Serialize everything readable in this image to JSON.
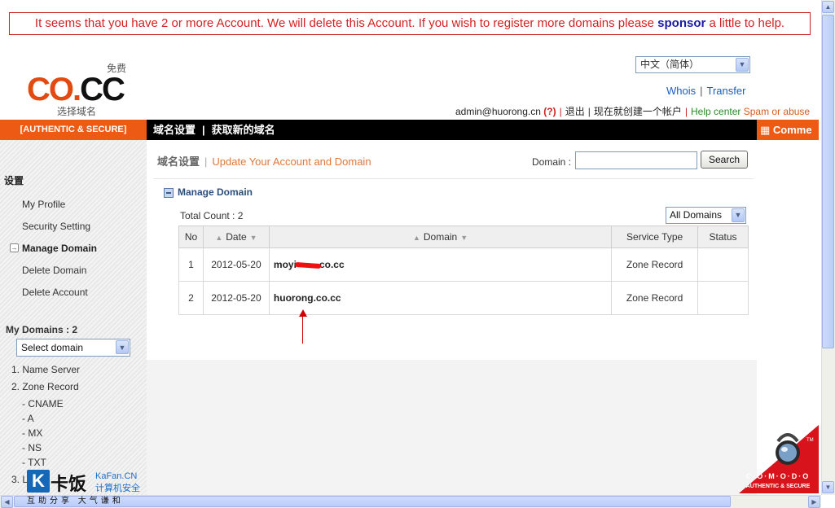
{
  "banner": {
    "text_before": "It seems that you have 2 or more Account. We will delete this Account. If you wish to register more domains please ",
    "sponsor": "sponsor",
    "text_after": " a little to help."
  },
  "logo": {
    "free": "免费",
    "co": "CO",
    "dot": ".",
    "cc": "CC",
    "subtitle": "选择域名"
  },
  "language": {
    "selected": "中文（简体）"
  },
  "top_links": {
    "whois": "Whois",
    "transfer": "Transfer",
    "sep": "|"
  },
  "user_line": {
    "email": "admin@huorong.cn",
    "question": "(?)",
    "logout": "退出",
    "create": "现在就创建一个帐户",
    "help": "Help center",
    "spam": "Spam or abuse"
  },
  "nav": {
    "authentic": "[AUTHENTIC & SECURE]",
    "domain_settings": "域名设置",
    "sep": "|",
    "get_new": "获取新的域名",
    "comments": "Comme"
  },
  "sidebar": {
    "title": "设置",
    "items": [
      "My Profile",
      "Security Setting",
      "Manage Domain",
      "Delete Domain",
      "Delete Account"
    ],
    "my_domains": "My Domains : 2",
    "select_domain": "Select domain",
    "zone_items": [
      "1. Name Server",
      "2. Zone Record",
      "- CNAME",
      "- A",
      "- MX",
      "- NS",
      "- TXT",
      "3. L"
    ]
  },
  "main": {
    "crumb_1": "域名设置",
    "crumb_sep": "|",
    "crumb_2": "Update Your Account and Domain",
    "domain_label": "Domain :",
    "search_button": "Search",
    "section_title": "Manage Domain",
    "total_count": "Total Count : 2",
    "filter": "All Domains",
    "columns": {
      "no": "No",
      "date": "Date",
      "domain": "Domain",
      "service": "Service Type",
      "status": "Status"
    },
    "rows": [
      {
        "no": "1",
        "date": "2012-05-20",
        "domain_pre": "moyi",
        "domain_post": "co.cc",
        "service": "Zone Record",
        "status": ""
      },
      {
        "no": "2",
        "date": "2012-05-20",
        "domain": "huorong.co.cc",
        "service": "Zone Record",
        "status": ""
      }
    ]
  },
  "comodo": {
    "name": "C·O·M·O·D·O",
    "tagline": "AUTHENTIC & SECURE",
    "tm": "TM"
  },
  "watermark": {
    "k": "K",
    "name": "卡饭",
    "en": "KaFan.CN",
    "cn": "计算机安全",
    "motto": "互助分享  大气谦和"
  },
  "icons": {
    "sort_up": "▲",
    "sort_down": "▼",
    "dropdown": "▼",
    "expand": "→"
  },
  "colors": {
    "accent_orange": "#ec5a14",
    "warning_red": "#d42020",
    "link_blue": "#1d5db8"
  }
}
